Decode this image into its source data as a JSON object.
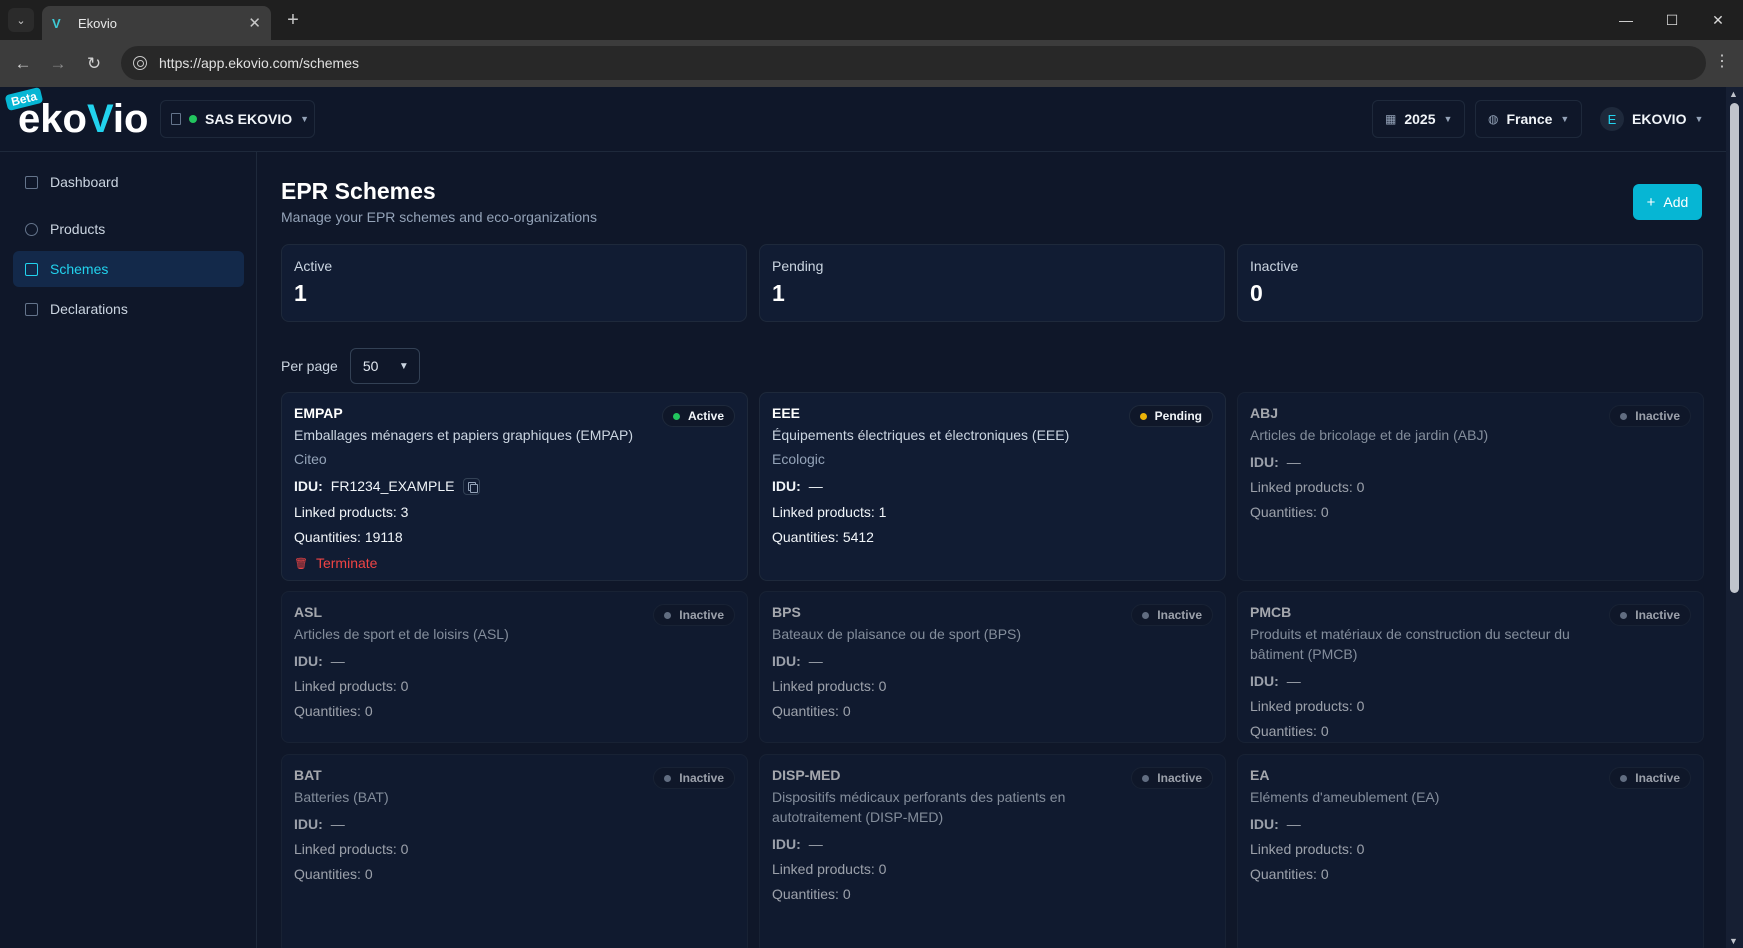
{
  "browser": {
    "tab_title": "Ekovio",
    "tab_favicon": "V",
    "url": "https://app.ekovio.com/schemes"
  },
  "header": {
    "beta_label": "Beta",
    "logo_text": {
      "part1": "eko",
      "part2": "V",
      "part3": "io"
    },
    "company": "SAS EKOVIO",
    "year": "2025",
    "country": "France",
    "user_initial": "E",
    "user_name": "EKOVIO"
  },
  "sidebar": {
    "items": [
      {
        "label": "Dashboard",
        "icon": "dashboard-icon",
        "active": false
      },
      {
        "label": "Products",
        "icon": "box-icon",
        "active": false
      },
      {
        "label": "Schemes",
        "icon": "building-icon",
        "active": true
      },
      {
        "label": "Declarations",
        "icon": "document-icon",
        "active": false
      }
    ]
  },
  "page": {
    "title": "EPR Schemes",
    "subtitle": "Manage your EPR schemes and eco-organizations",
    "add_label": "Add",
    "per_page_label": "Per page",
    "per_page_value": "50"
  },
  "stats": [
    {
      "label": "Active",
      "value": "1"
    },
    {
      "label": "Pending",
      "value": "1"
    },
    {
      "label": "Inactive",
      "value": "0"
    }
  ],
  "colors": {
    "accent": "#06b6d4",
    "active": "#22c55e",
    "pending": "#eab308",
    "inactive": "#94a3b8",
    "danger": "#ef4444"
  },
  "labels": {
    "idu": "IDU:",
    "terminate": "Terminate"
  },
  "schemes": [
    {
      "code": "EMPAP",
      "name": "Emballages ménagers et papiers graphiques (EMPAP)",
      "org": "Citeo",
      "status": "Active",
      "idu": "FR1234_EXAMPLE",
      "linked": "Linked products: 3",
      "quantities": "Quantities: 19118"
    },
    {
      "code": "EEE",
      "name": "Équipements électriques et électroniques (EEE)",
      "org": "Ecologic",
      "status": "Pending",
      "idu": "—",
      "linked": "Linked products: 1",
      "quantities": "Quantities: 5412"
    },
    {
      "code": "ABJ",
      "name": "Articles de bricolage et de jardin (ABJ)",
      "org": "",
      "status": "Inactive",
      "idu": "—",
      "linked": "Linked products: 0",
      "quantities": "Quantities: 0"
    },
    {
      "code": "ASL",
      "name": "Articles de sport et de loisirs (ASL)",
      "org": "",
      "status": "Inactive",
      "idu": "—",
      "linked": "Linked products: 0",
      "quantities": "Quantities: 0"
    },
    {
      "code": "BPS",
      "name": "Bateaux de plaisance ou de sport (BPS)",
      "org": "",
      "status": "Inactive",
      "idu": "—",
      "linked": "Linked products: 0",
      "quantities": "Quantities: 0"
    },
    {
      "code": "PMCB",
      "name": "Produits et matériaux de construction du secteur du bâtiment (PMCB)",
      "org": "",
      "status": "Inactive",
      "idu": "—",
      "linked": "Linked products: 0",
      "quantities": "Quantities: 0"
    },
    {
      "code": "BAT",
      "name": "Batteries (BAT)",
      "org": "",
      "status": "Inactive",
      "idu": "—",
      "linked": "Linked products: 0",
      "quantities": "Quantities: 0"
    },
    {
      "code": "DISP-MED",
      "name": "Dispositifs médicaux perforants des patients en autotraitement (DISP-MED)",
      "org": "",
      "status": "Inactive",
      "idu": "—",
      "linked": "Linked products: 0",
      "quantities": "Quantities: 0"
    },
    {
      "code": "EA",
      "name": "Eléments d'ameublement (EA)",
      "org": "",
      "status": "Inactive",
      "idu": "—",
      "linked": "Linked products: 0",
      "quantities": "Quantities: 0"
    }
  ]
}
